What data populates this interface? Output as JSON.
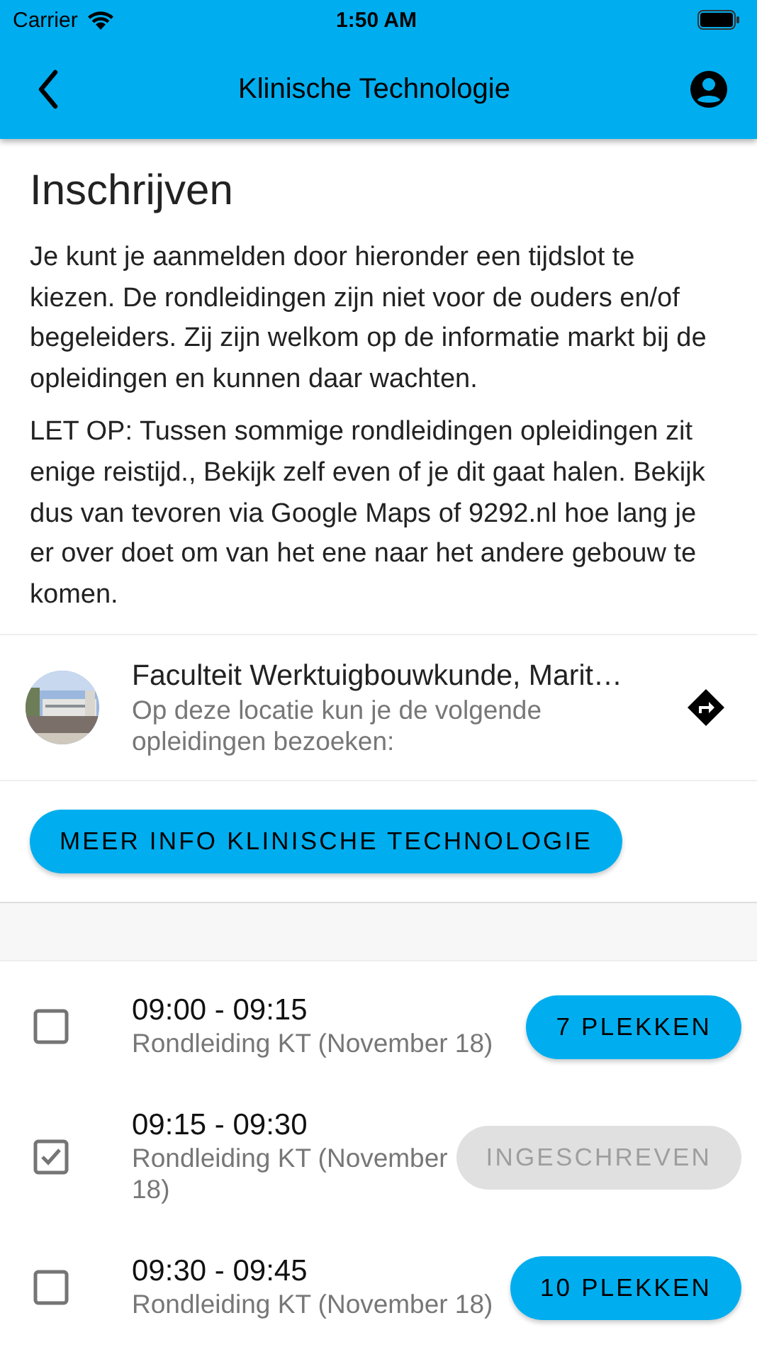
{
  "status_bar": {
    "carrier": "Carrier",
    "time": "1:50 AM"
  },
  "app_bar": {
    "title": "Klinische Technologie"
  },
  "heading": "Inschrijven",
  "paragraphs": [
    "Je kunt je aanmelden door hieronder een tijdslot te kiezen. De rondleidingen zijn niet voor de ouders en/of begeleiders. Zij zijn welkom op de informatie markt bij de opleidingen en kunnen daar wachten.",
    "LET OP: Tussen sommige rondleidingen opleidingen zit enige reistijd., Bekijk zelf even of je dit gaat halen. Bekijk dus van tevoren via Google Maps of 9292.nl hoe lang je er over doet om van het ene naar het andere gebouw te komen."
  ],
  "location": {
    "title": "Faculteit Werktuigbouwkunde, Marit…",
    "subtitle": "Op deze locatie kun je de volgende opleidingen bezoeken:"
  },
  "info_button": "MEER INFO KLINISCHE TECHNOLOGIE",
  "slots": [
    {
      "time": "09:00 - 09:15",
      "subtitle": "Rondleiding KT (November 18)",
      "checked": false,
      "button": "7 PLEKKEN",
      "disabled": false
    },
    {
      "time": "09:15 - 09:30",
      "subtitle": "Rondleiding KT (November 18)",
      "checked": true,
      "button": "INGESCHREVEN",
      "disabled": true
    },
    {
      "time": "09:30 - 09:45",
      "subtitle": "Rondleiding KT (November 18)",
      "checked": false,
      "button": "10 PLEKKEN",
      "disabled": false
    }
  ]
}
